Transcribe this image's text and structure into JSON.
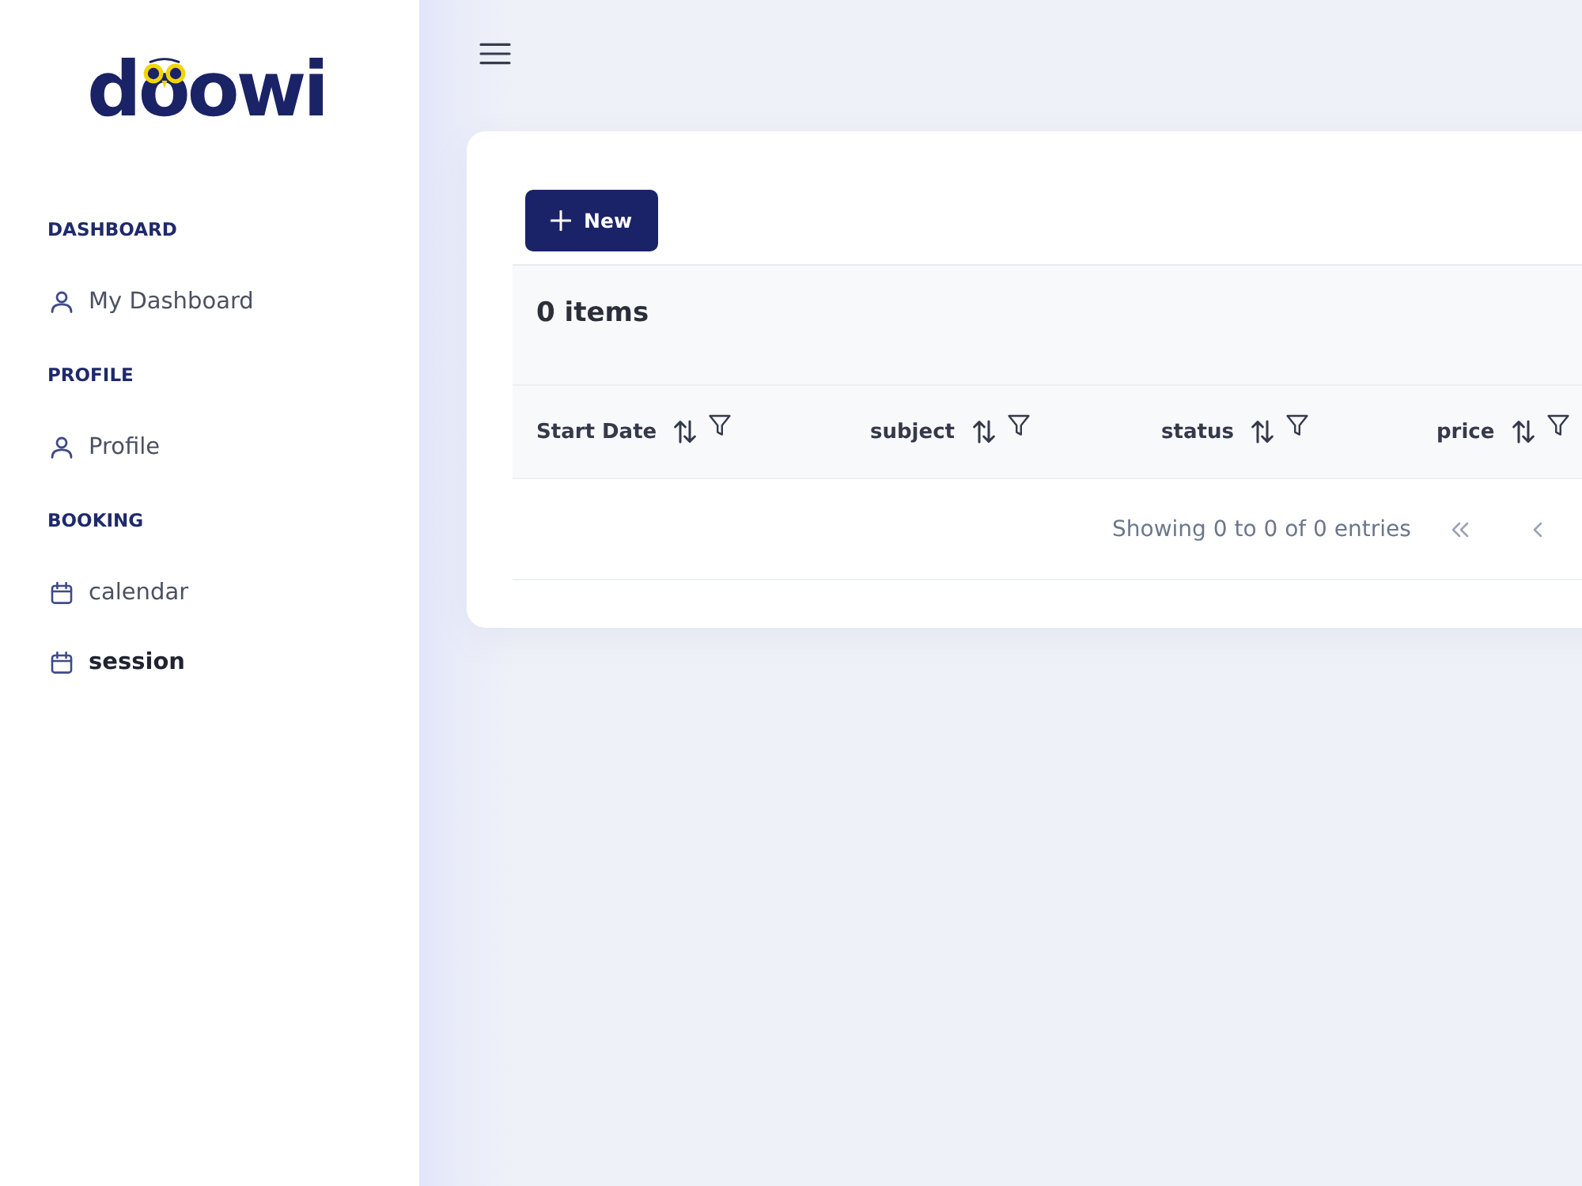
{
  "sidebar": {
    "logo": "doowi",
    "sections": [
      {
        "heading": "DASHBOARD",
        "items": [
          {
            "label": "My Dashboard",
            "kind": "account",
            "selected": false
          }
        ]
      },
      {
        "heading": "PROFILE",
        "items": [
          {
            "label": "Profile",
            "kind": "account",
            "selected": false
          }
        ]
      },
      {
        "heading": "BOOKING",
        "items": [
          {
            "label": "calendar",
            "kind": "booking",
            "selected": false
          },
          {
            "label": "session",
            "kind": "booking",
            "selected": true
          }
        ]
      }
    ]
  },
  "table": {
    "new_button": "New",
    "item_count": "0 items",
    "columns": [
      {
        "label": "Start Date"
      },
      {
        "label": "subject"
      },
      {
        "label": "status"
      },
      {
        "label": "price"
      }
    ],
    "paginator": {
      "summary": "Showing 0 to 0 of 0 entries"
    }
  }
}
